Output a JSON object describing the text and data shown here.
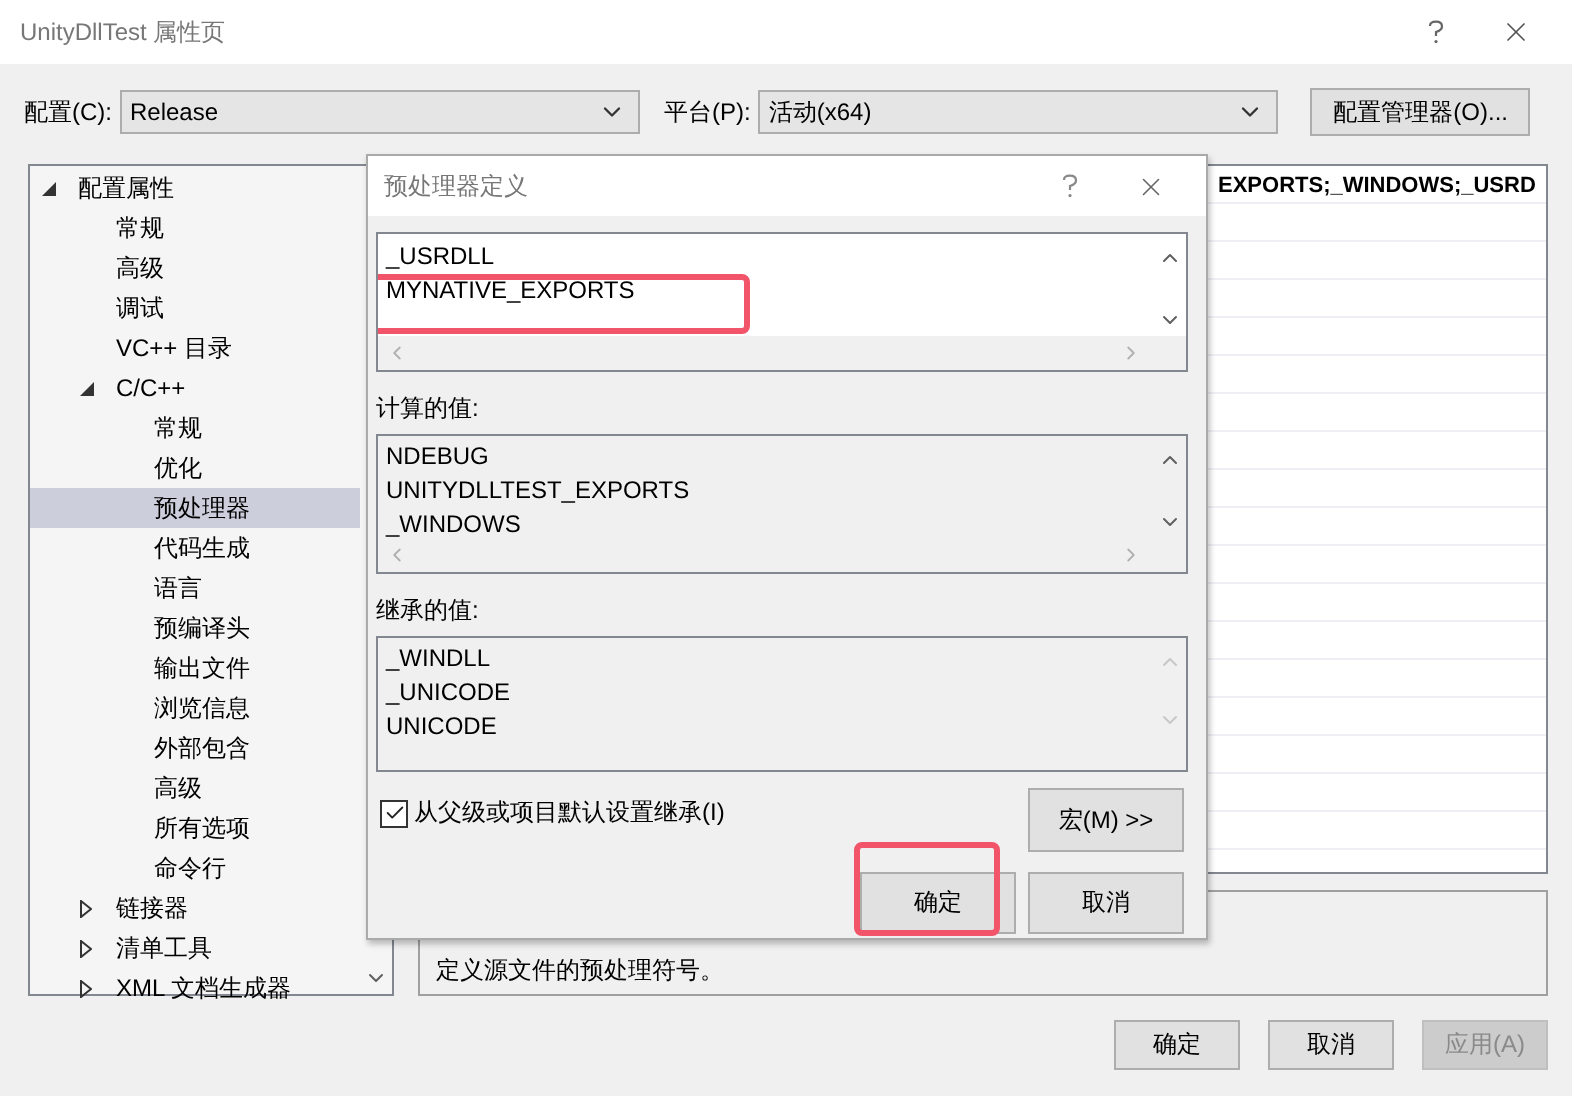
{
  "window": {
    "title": "UnityDllTest 属性页"
  },
  "toolbar": {
    "config_label": "配置(C):",
    "config_value": "Release",
    "platform_label": "平台(P):",
    "platform_value": "活动(x64)",
    "manager_button": "配置管理器(O)..."
  },
  "tree": {
    "items": [
      {
        "label": "配置属性",
        "expanded": true,
        "selected": false,
        "children": [
          {
            "label": "常规",
            "selected": false
          },
          {
            "label": "高级",
            "selected": false
          },
          {
            "label": "调试",
            "selected": false
          },
          {
            "label": "VC++ 目录",
            "selected": false
          },
          {
            "label": "C/C++",
            "expanded": true,
            "selected": false,
            "children": [
              {
                "label": "常规",
                "selected": false
              },
              {
                "label": "优化",
                "selected": false
              },
              {
                "label": "预处理器",
                "selected": true
              },
              {
                "label": "代码生成",
                "selected": false
              },
              {
                "label": "语言",
                "selected": false
              },
              {
                "label": "预编译头",
                "selected": false
              },
              {
                "label": "输出文件",
                "selected": false
              },
              {
                "label": "浏览信息",
                "selected": false
              },
              {
                "label": "外部包含",
                "selected": false
              },
              {
                "label": "高级",
                "selected": false
              },
              {
                "label": "所有选项",
                "selected": false
              },
              {
                "label": "命令行",
                "selected": false
              }
            ]
          },
          {
            "label": "链接器",
            "expanded": false,
            "selected": false
          },
          {
            "label": "清单工具",
            "expanded": false,
            "selected": false
          },
          {
            "label": "XML 文档生成器",
            "expanded": false,
            "selected": false
          }
        ]
      }
    ]
  },
  "property_grid": {
    "visible_value": "EXPORTS;_WINDOWS;_USRD"
  },
  "description": "定义源文件的预处理符号。",
  "dialog": {
    "title": "预处理器定义",
    "definitions": [
      {
        "text": "_USRDLL",
        "highlighted": false
      },
      {
        "text": "MYNATIVE_EXPORTS",
        "highlighted": true
      }
    ],
    "evaluated_label": "计算的值:",
    "evaluated": [
      "NDEBUG",
      "UNITYDLLTEST_EXPORTS",
      "_WINDOWS"
    ],
    "inherited_label": "继承的值:",
    "inherited": [
      "_WINDLL",
      "_UNICODE",
      "UNICODE"
    ],
    "inherit_checkbox": {
      "label": "从父级或项目默认设置继承(I)",
      "checked": true
    },
    "macro_button": "宏(M) >>",
    "buttons": [
      {
        "label": "确定",
        "highlighted": true
      },
      {
        "label": "取消",
        "highlighted": false
      }
    ]
  },
  "buttons": [
    {
      "label": "确定",
      "disabled": false
    },
    {
      "label": "取消",
      "disabled": false
    },
    {
      "label": "应用(A)",
      "disabled": true
    }
  ]
}
